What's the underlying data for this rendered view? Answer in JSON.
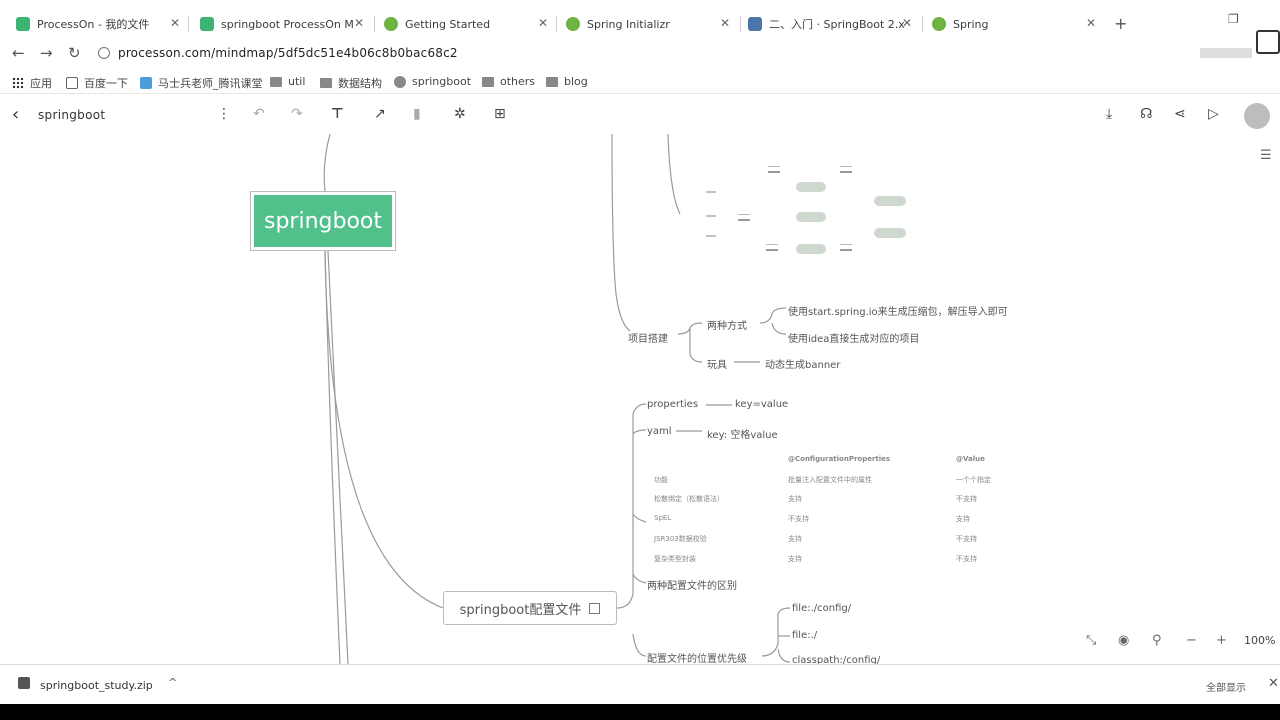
{
  "browser": {
    "tabs": [
      {
        "title": "ProcessOn - 我的文件",
        "color": "#3cb371"
      },
      {
        "title": "springboot ProcessOn M",
        "color": "#3cb371"
      },
      {
        "title": "Getting Started",
        "color": "#6db33f"
      },
      {
        "title": "Spring Initializr",
        "color": "#6db33f"
      },
      {
        "title": "二、入门 · SpringBoot 2.x",
        "color": "#4a76a8"
      },
      {
        "title": "Spring",
        "color": "#6db33f"
      }
    ],
    "new_tab": "+",
    "url": "processon.com/mindmap/5df5dc51e4b06c8b0bac68c2",
    "bookmarks": [
      "应用",
      "百度一下",
      "马士兵老师_腾讯课堂",
      "util",
      "数据结构",
      "springboot",
      "others",
      "blog"
    ]
  },
  "app": {
    "doc_title": "springboot",
    "zoom": "100%"
  },
  "mindmap": {
    "root": "springboot",
    "project_setup": {
      "label": "项目搭建",
      "two_ways": "两种方式",
      "way1": "使用start.spring.io来生成压缩包，解压导入即可",
      "way2": "使用idea直接生成对应的项目",
      "fun": "玩具",
      "banner": "动态生成banner"
    },
    "config": {
      "label": "springboot配置文件",
      "properties": "properties",
      "properties_value": "key=value",
      "yaml": "yaml",
      "yaml_value": "key: 空格value",
      "compare_table": {
        "headers": [
          "",
          "@ConfigurationProperties",
          "@Value"
        ],
        "rows": [
          [
            "功能",
            "批量注入配置文件中的属性",
            "一个个指定"
          ],
          [
            "松散绑定（松散语法）",
            "支持",
            "不支持"
          ],
          [
            "SpEL",
            "不支持",
            "支持"
          ],
          [
            "JSR303数据校验",
            "支持",
            "不支持"
          ],
          [
            "复杂类型封装",
            "支持",
            "不支持"
          ]
        ]
      },
      "diff_label": "两种配置文件的区别",
      "location_label": "配置文件的位置优先级",
      "locations": [
        "file:./config/",
        "file:./",
        "classpath:/config/"
      ]
    }
  },
  "downloads": {
    "file": "springboot_study.zip",
    "show_all": "全部显示"
  }
}
